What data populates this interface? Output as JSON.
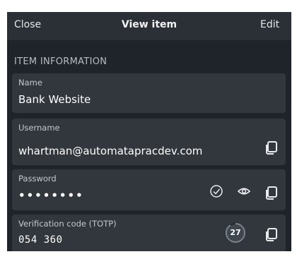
{
  "header": {
    "close_label": "Close",
    "title": "View item",
    "edit_label": "Edit"
  },
  "section_title": "ITEM INFORMATION",
  "fields": {
    "name": {
      "label": "Name",
      "value": "Bank Website"
    },
    "username": {
      "label": "Username",
      "value": "whartman@automatapracdev.com"
    },
    "password": {
      "label": "Password",
      "value": "••••••••"
    },
    "totp": {
      "label": "Verification code (TOTP)",
      "value": "054 360",
      "seconds_remaining": "27",
      "timer_fraction": 0.9
    }
  },
  "colors": {
    "panel": "#1f242a",
    "header": "#2b3036",
    "field": "#32373d",
    "text": "#ffffff",
    "muted": "#c4c8cd"
  },
  "icons": [
    "copy-icon",
    "check-circle-icon",
    "eye-icon"
  ]
}
